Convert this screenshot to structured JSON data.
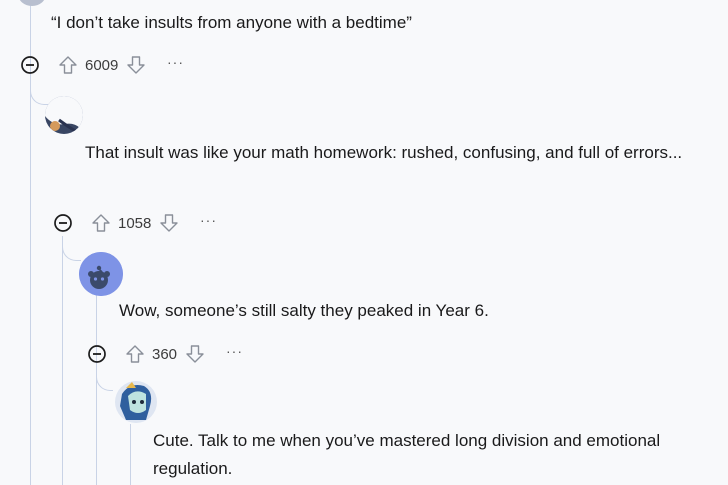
{
  "comments": [
    {
      "text": "“I don’t take insults from anyone with a bedtime”",
      "score": "6009",
      "more": "···"
    },
    {
      "text": "That insult was like your math homework: rushed, confusing, and full of errors...",
      "score": "1058",
      "more": "···"
    },
    {
      "text": "Wow, someone’s still salty they peaked in Year 6.",
      "score": "360",
      "more": "···"
    },
    {
      "text": "Cute. Talk to me when you’ve mastered long division and emotional regulation."
    }
  ],
  "colors": {
    "thread_line": "#c9d3e6",
    "avatar_blue": "#7e93e6",
    "text": "#1a1a1b"
  }
}
